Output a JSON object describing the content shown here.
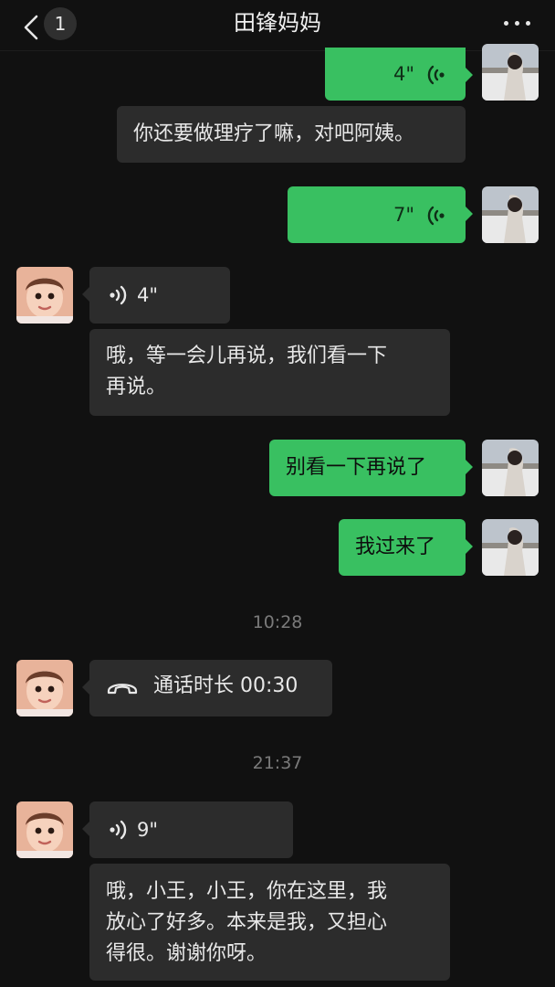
{
  "header": {
    "back_label": "<",
    "unread_count": "1",
    "title": "田锋妈妈",
    "more_icon": "more-dots-icon"
  },
  "colors": {
    "background": "#111111",
    "incoming_bubble": "#2c2c2c",
    "outgoing_bubble": "#39c061",
    "timestamp_text": "#7a7a7a"
  },
  "messages": {
    "m1": {
      "sender": "me",
      "type": "voice",
      "duration": "4\""
    },
    "m2": {
      "sender": "me",
      "type": "text",
      "text": "你还要做理疗了嘛，对吧阿姨。"
    },
    "m3": {
      "sender": "me",
      "type": "voice",
      "duration": "7\""
    },
    "m4": {
      "sender": "contact",
      "type": "voice",
      "duration": "4\""
    },
    "m5": {
      "sender": "contact",
      "type": "text",
      "line1": "哦，等一会儿再说，我们看一下",
      "line2": "再说。"
    },
    "m6": {
      "sender": "me",
      "type": "text",
      "text": "别看一下再说了"
    },
    "m7": {
      "sender": "me",
      "type": "text",
      "text": "我过来了"
    },
    "ts1": {
      "type": "timestamp",
      "text": "10:28"
    },
    "m8": {
      "sender": "contact",
      "type": "call",
      "text": "通话时长 00:30"
    },
    "ts2": {
      "type": "timestamp",
      "text": "21:37"
    },
    "m9": {
      "sender": "contact",
      "type": "voice",
      "duration": "9\""
    },
    "m10": {
      "sender": "contact",
      "type": "text",
      "line1": "哦，小王，小王，你在这里，我",
      "line2": "放心了好多。本来是我，又担心",
      "line3": "得很。谢谢你呀。"
    }
  }
}
